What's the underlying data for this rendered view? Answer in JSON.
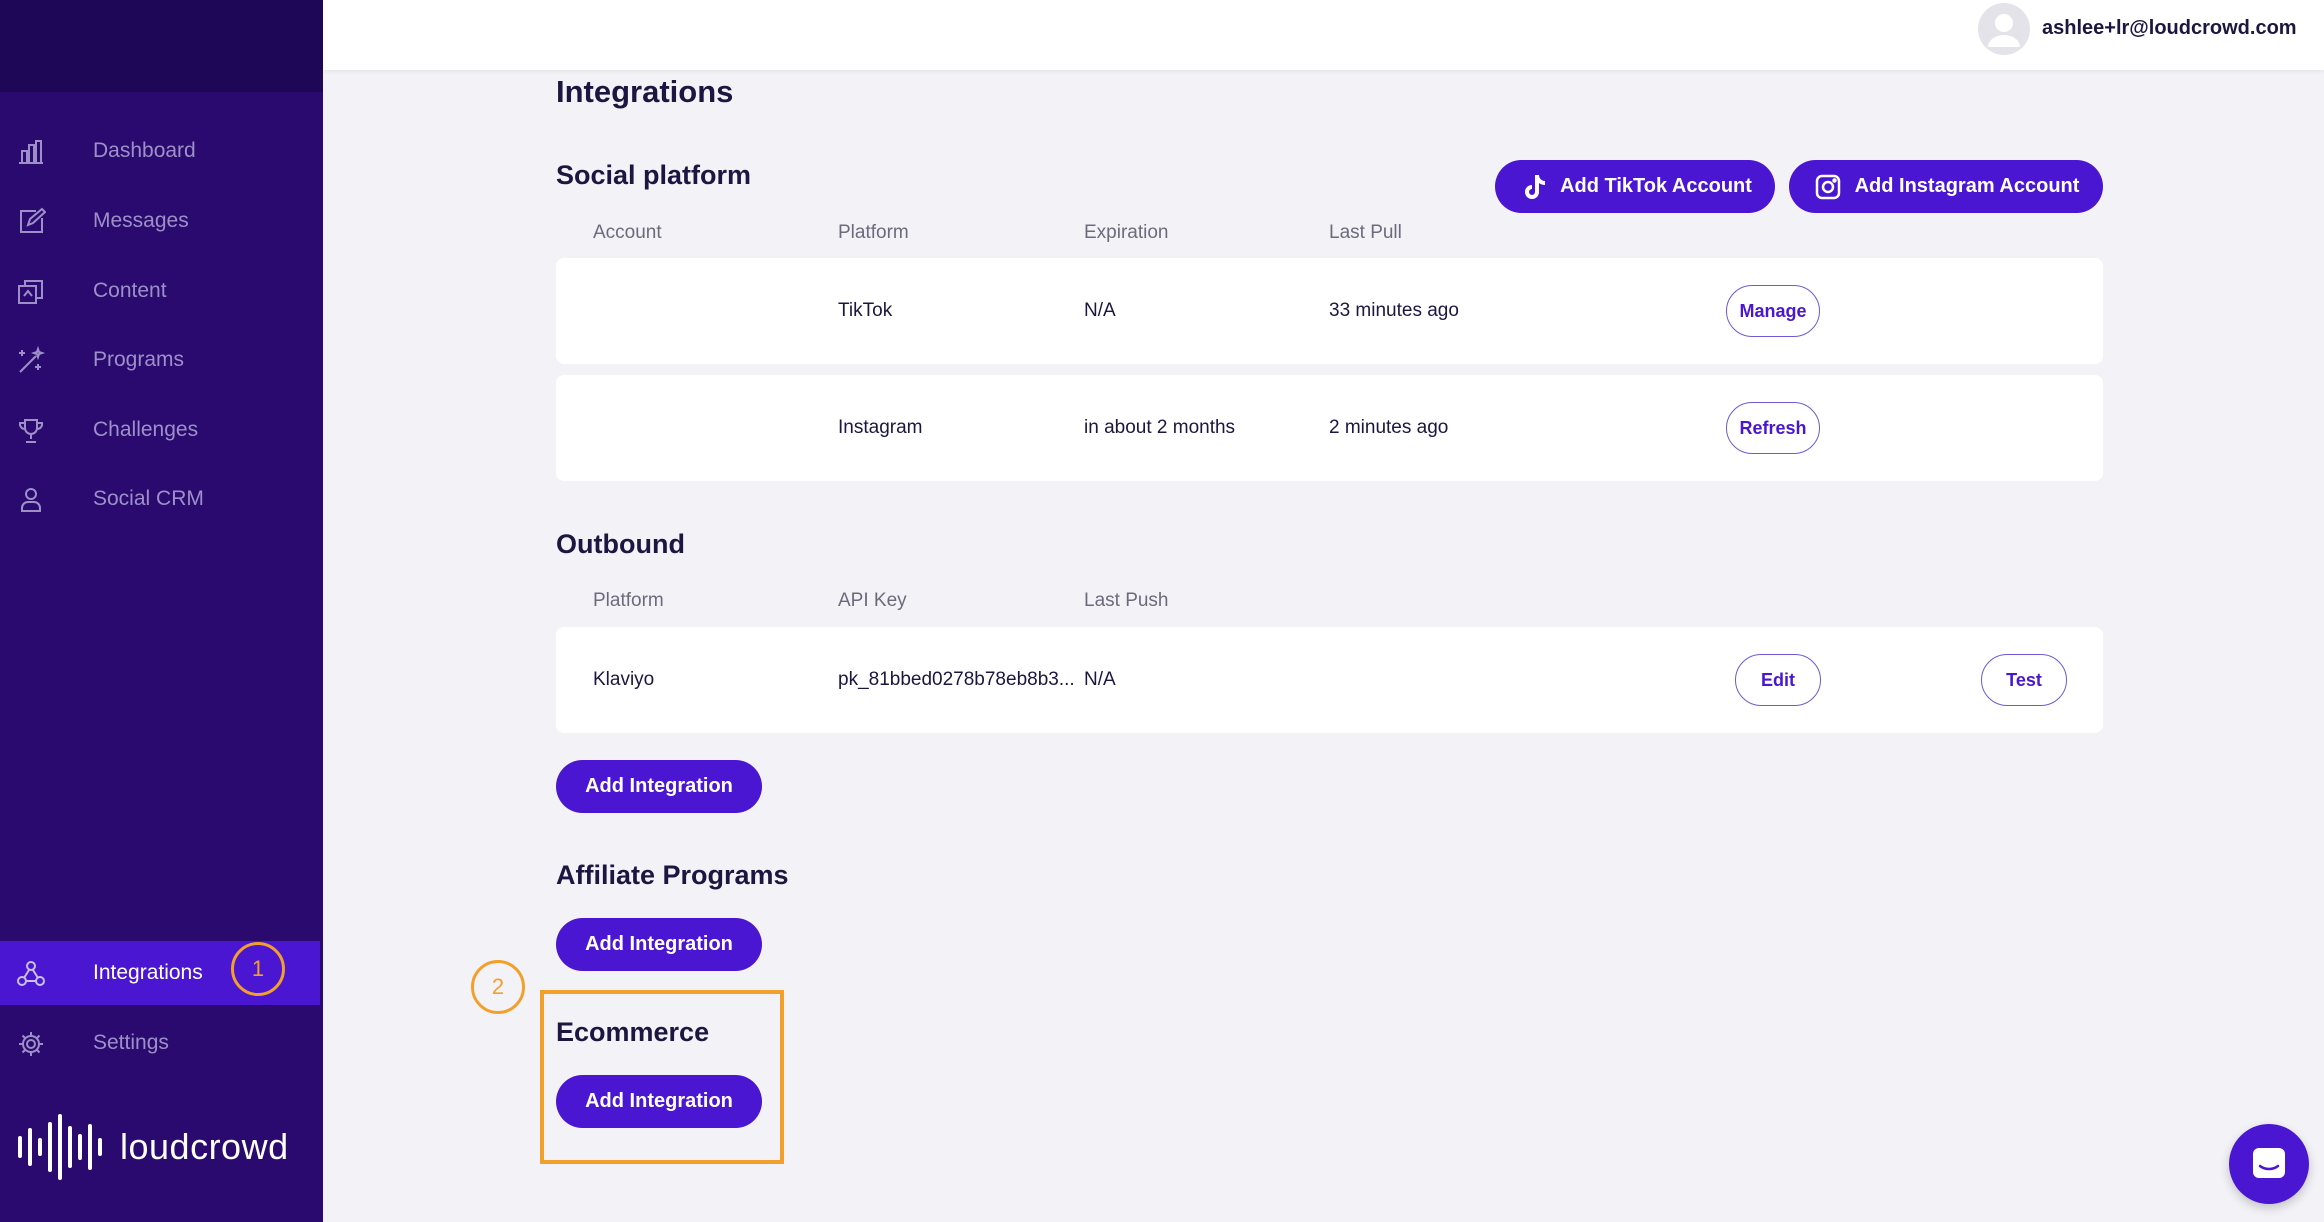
{
  "sidebar": {
    "items": [
      {
        "label": "Dashboard",
        "icon": "bar-chart-icon"
      },
      {
        "label": "Messages",
        "icon": "edit-message-icon"
      },
      {
        "label": "Content",
        "icon": "content-icon"
      },
      {
        "label": "Programs",
        "icon": "sparkle-icon"
      },
      {
        "label": "Challenges",
        "icon": "trophy-icon"
      },
      {
        "label": "Social CRM",
        "icon": "person-icon"
      },
      {
        "label": "Integrations",
        "icon": "integrations-icon",
        "active": true
      },
      {
        "label": "Settings",
        "icon": "gear-icon"
      }
    ],
    "logo_text": "loudcrowd"
  },
  "annotations": {
    "marker_1": "1",
    "marker_2": "2"
  },
  "header": {
    "user_email": "ashlee+lr@loudcrowd.com"
  },
  "page": {
    "title": "Integrations"
  },
  "social": {
    "title": "Social platform",
    "add_tiktok": "Add TikTok Account",
    "add_instagram": "Add Instagram Account",
    "columns": [
      "Account",
      "Platform",
      "Expiration",
      "Last Pull"
    ],
    "rows": [
      {
        "account": "",
        "platform": "TikTok",
        "expiration": "N/A",
        "last_pull": "33 minutes ago",
        "action": "Manage"
      },
      {
        "account": "",
        "platform": "Instagram",
        "expiration": "in about 2 months",
        "last_pull": "2 minutes ago",
        "action": "Refresh"
      }
    ]
  },
  "outbound": {
    "title": "Outbound",
    "columns": [
      "Platform",
      "API Key",
      "Last Push"
    ],
    "rows": [
      {
        "platform": "Klaviyo",
        "api_key": "pk_81bbed0278b78eb8b3...",
        "last_push": "N/A",
        "edit": "Edit",
        "test": "Test"
      }
    ],
    "add_button": "Add Integration"
  },
  "affiliate": {
    "title": "Affiliate Programs",
    "add_button": "Add Integration"
  },
  "ecommerce": {
    "title": "Ecommerce",
    "add_button": "Add Integration"
  },
  "colors": {
    "sidebar_bg": "#2a0a6e",
    "accent": "#4a16d1",
    "highlight": "#f2a02b",
    "page_bg": "#f3f2f7"
  }
}
